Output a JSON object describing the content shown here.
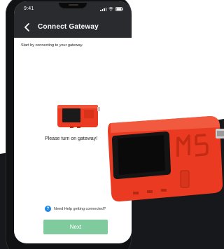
{
  "status_bar": {
    "time": "9:41"
  },
  "app_bar": {
    "title": "Connect Gateway",
    "back_icon": "back-arrow-icon"
  },
  "content": {
    "intro_text": "Start by connecting to your gateway.",
    "instruction": "Please turn on gateway!",
    "help_text": "Need Help getting connected?",
    "help_icon": "question-icon",
    "next_label": "Next"
  },
  "device": {
    "brand_mark": "M5"
  },
  "colors": {
    "app_bar": "#2a2b2f",
    "device_orange": "#ea3b22",
    "next_button": "#7fcb9d",
    "help_icon": "#1e88e5",
    "dark_background": "#17181b"
  }
}
